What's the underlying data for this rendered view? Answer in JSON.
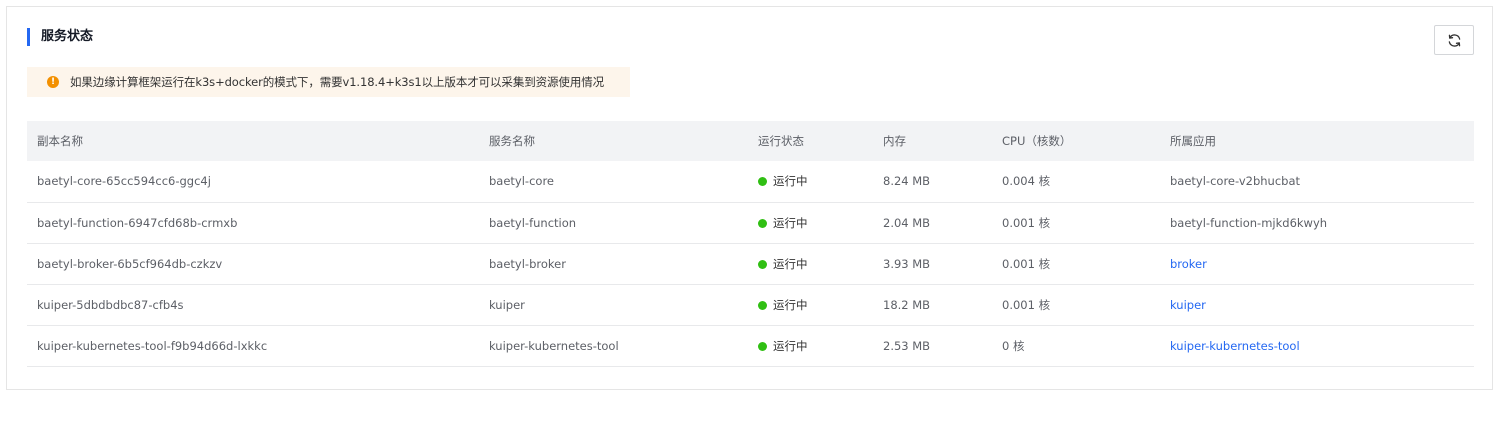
{
  "section": {
    "title": "服务状态",
    "alert": "如果边缘计算框架运行在k3s+docker的模式下，需要v1.18.4+k3s1以上版本才可以采集到资源使用情况"
  },
  "colors": {
    "accent": "#2468f2",
    "warning": "#f39000",
    "alert_bg": "#fdf5eb",
    "running": "#30bf13",
    "header_bg": "#f2f3f5"
  },
  "icons": {
    "refresh": "refresh-icon",
    "warning": "warning-icon"
  },
  "table": {
    "headers": [
      "副本名称",
      "服务名称",
      "运行状态",
      "内存",
      "CPU（核数）",
      "所属应用"
    ],
    "rows": [
      {
        "replica": "baetyl-core-65cc594cc6-ggc4j",
        "service": "baetyl-core",
        "status": "运行中",
        "memory": "8.24 MB",
        "cpu": "0.004 核",
        "app": "baetyl-core-v2bhucbat",
        "app_link": false
      },
      {
        "replica": "baetyl-function-6947cfd68b-crmxb",
        "service": "baetyl-function",
        "status": "运行中",
        "memory": "2.04 MB",
        "cpu": "0.001 核",
        "app": "baetyl-function-mjkd6kwyh",
        "app_link": false
      },
      {
        "replica": "baetyl-broker-6b5cf964db-czkzv",
        "service": "baetyl-broker",
        "status": "运行中",
        "memory": "3.93 MB",
        "cpu": "0.001 核",
        "app": "broker",
        "app_link": true
      },
      {
        "replica": "kuiper-5dbdbdbc87-cfb4s",
        "service": "kuiper",
        "status": "运行中",
        "memory": "18.2 MB",
        "cpu": "0.001 核",
        "app": "kuiper",
        "app_link": true
      },
      {
        "replica": "kuiper-kubernetes-tool-f9b94d66d-lxkkc",
        "service": "kuiper-kubernetes-tool",
        "status": "运行中",
        "memory": "2.53 MB",
        "cpu": "0 核",
        "app": "kuiper-kubernetes-tool",
        "app_link": true
      }
    ]
  }
}
